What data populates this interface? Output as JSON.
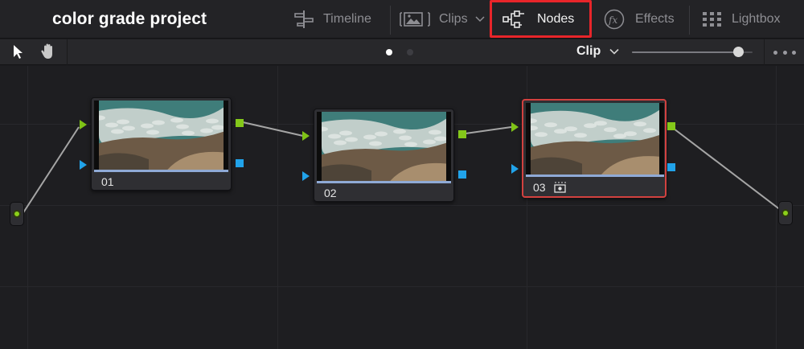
{
  "header": {
    "project_title": "color grade project",
    "tabs": [
      {
        "label": "Timeline",
        "icon": "timeline-icon"
      },
      {
        "label": "Clips",
        "icon": "clips-icon"
      },
      {
        "label": "Nodes",
        "icon": "nodes-icon",
        "active": true
      },
      {
        "label": "Effects",
        "icon": "fx-icon"
      },
      {
        "label": "Lightbox",
        "icon": "lightbox-icon"
      }
    ]
  },
  "toolbar": {
    "tools": [
      "pointer-tool-icon",
      "hand-tool-icon"
    ],
    "page_dots": {
      "count": 2,
      "active": 0
    },
    "mode_label": "Clip",
    "zoom_level_fraction": 0.88
  },
  "nodes": [
    {
      "label": "01",
      "selected": false
    },
    {
      "label": "02",
      "selected": false
    },
    {
      "label": "03",
      "selected": true,
      "badge": "effect-badge-icon"
    }
  ],
  "colors": {
    "accent_red": "#e8252a",
    "port_green": "#84c81a",
    "port_blue": "#21a3ea",
    "node_bar": "#8faad6"
  }
}
